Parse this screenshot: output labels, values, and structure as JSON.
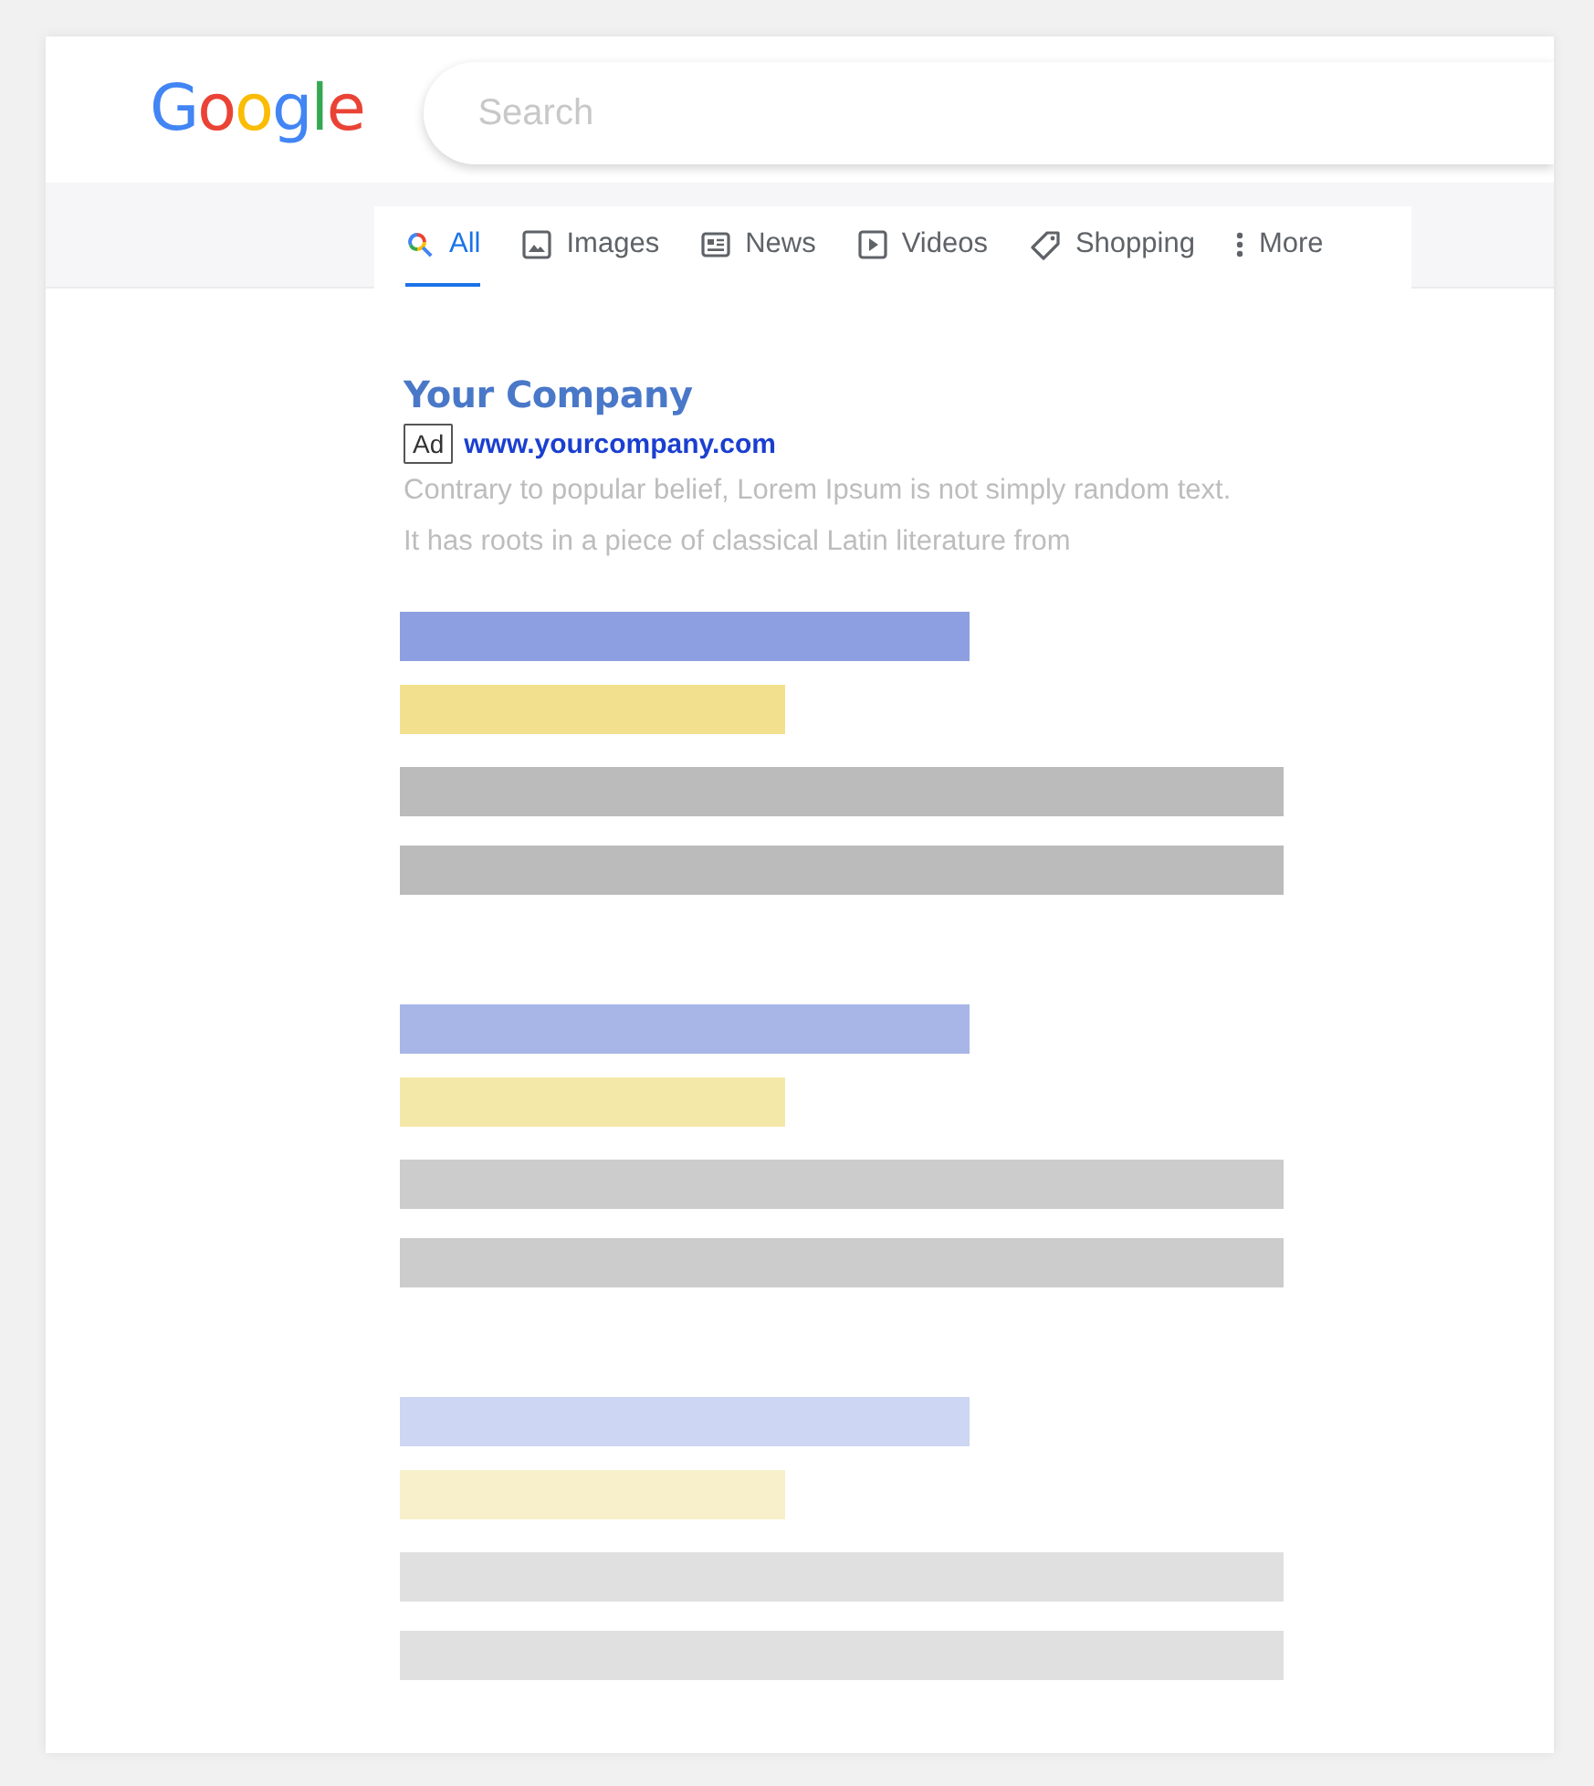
{
  "logo": "Google",
  "search": {
    "placeholder": "Search"
  },
  "tabs": [
    {
      "label": "All",
      "kind": "search",
      "selected": true
    },
    {
      "label": "Images",
      "kind": "image",
      "selected": false
    },
    {
      "label": "News",
      "kind": "news",
      "selected": false
    },
    {
      "label": "Videos",
      "kind": "video",
      "selected": false
    },
    {
      "label": "Shopping",
      "kind": "tag",
      "selected": false
    },
    {
      "label": "More",
      "kind": "dots",
      "selected": false
    }
  ],
  "ad": {
    "title": "Your Company",
    "badge": "Ad",
    "url": "www.yourcompany.com",
    "description": "Contrary to popular belief, Lorem Ipsum is not simply random text. It has roots in a piece of classical Latin literature from"
  },
  "skeleton_results": [
    {
      "kind": "bars"
    },
    {
      "kind": "bars"
    },
    {
      "kind": "bars"
    }
  ]
}
